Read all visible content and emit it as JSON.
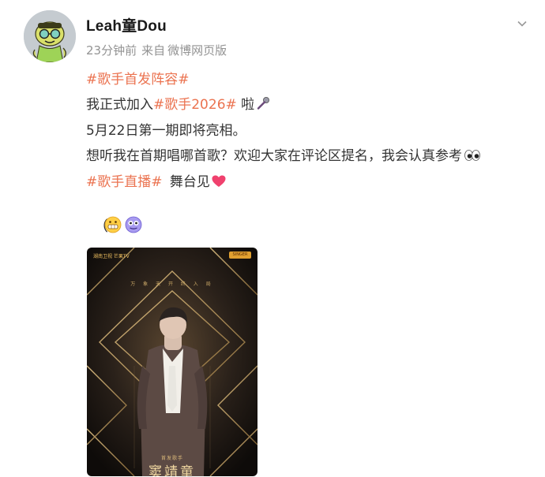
{
  "post": {
    "username": "Leah童Dou",
    "time": "23分钟前",
    "source_prefix": "来自",
    "source": "微博网页版",
    "lines": [
      {
        "tag1": "#歌手首发阵容#"
      },
      {
        "pre": "我正式加入",
        "tag": "#歌手2026#",
        "post": "啦"
      },
      {
        "text": "5月22日第一期即将亮相。"
      },
      {
        "text": "想听我在首期唱哪首歌？欢迎大家在评论区提名，我会认真参考"
      },
      {
        "tag": "#歌手直播#",
        "post": "舞台见"
      }
    ],
    "emoji_row_paren": "（",
    "emojis": {
      "microphone": "microphone-icon",
      "eyes": "eyes-icon",
      "heart": "heart-icon",
      "grimace": "grimace-emoji-icon",
      "purple": "purple-face-emoji-icon"
    }
  },
  "poster": {
    "logos": "湖南卫视 芒果TV",
    "badge": "SINGER",
    "subtitle": "万 象 天 开   终 入 局",
    "role": "首发歌手",
    "name": "窦靖童"
  },
  "colors": {
    "tag": "#eb7350",
    "meta": "#939393",
    "text": "#333333"
  }
}
